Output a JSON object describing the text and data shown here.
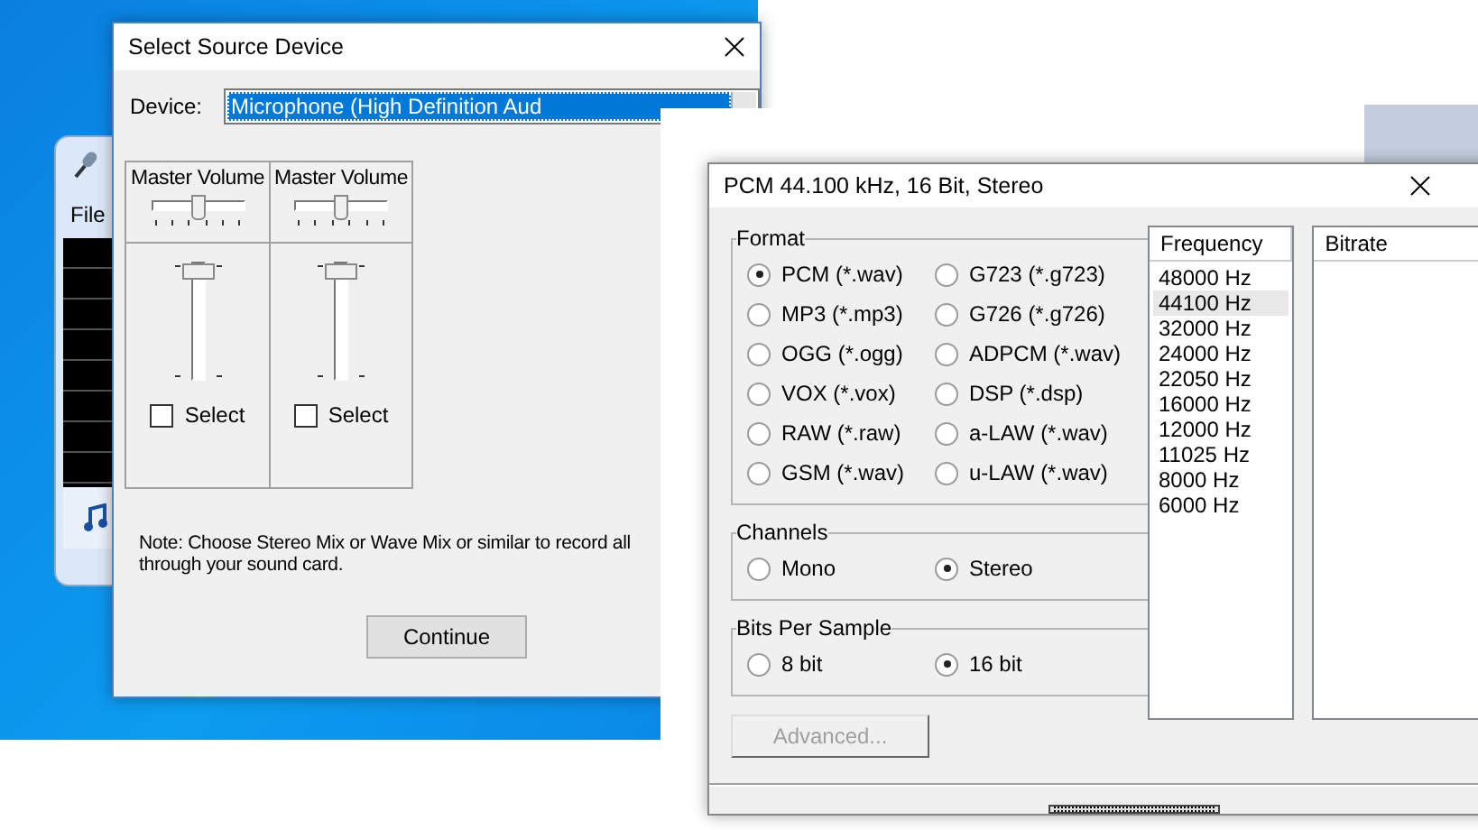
{
  "back_window": {
    "menu": "File"
  },
  "source_dialog": {
    "title": "Select Source Device",
    "device_label": "Device:",
    "device_value": "Microphone (High Definition Aud",
    "mixers": [
      {
        "label": "Master Volume",
        "balance": {
          "level": 0.5
        },
        "volume": {
          "level": 0.95
        },
        "select": {
          "label": "Select",
          "checked": false
        }
      },
      {
        "label": "Master Volume",
        "balance": {
          "level": 0.5
        },
        "volume": {
          "level": 0.95
        },
        "select": {
          "label": "Select",
          "checked": false
        }
      }
    ],
    "note_lines": [
      "Note: Choose Stereo Mix or Wave Mix or similar to record all",
      "through your sound card."
    ],
    "button": "Continue"
  },
  "format_dialog": {
    "title": "PCM 44.100 kHz, 16 Bit, Stereo",
    "format": {
      "legend": "Format",
      "options": [
        {
          "label": "PCM (*.wav)",
          "selected": true
        },
        {
          "label": "G723 (*.g723)",
          "selected": false
        },
        {
          "label": "MP3 (*.mp3)",
          "selected": false
        },
        {
          "label": "G726 (*.g726)",
          "selected": false
        },
        {
          "label": "OGG (*.ogg)",
          "selected": false
        },
        {
          "label": "ADPCM (*.wav)",
          "selected": false
        },
        {
          "label": "VOX (*.vox)",
          "selected": false
        },
        {
          "label": "DSP (*.dsp)",
          "selected": false
        },
        {
          "label": "RAW (*.raw)",
          "selected": false
        },
        {
          "label": "a-LAW (*.wav)",
          "selected": false
        },
        {
          "label": "GSM (*.wav)",
          "selected": false
        },
        {
          "label": "u-LAW (*.wav)",
          "selected": false
        }
      ]
    },
    "channels": {
      "legend": "Channels",
      "options": [
        {
          "label": "Mono",
          "selected": false
        },
        {
          "label": "Stereo",
          "selected": true
        }
      ]
    },
    "bits": {
      "legend": "Bits Per Sample",
      "options": [
        {
          "label": "8 bit",
          "selected": false
        },
        {
          "label": "16 bit",
          "selected": true
        }
      ]
    },
    "advanced_button": {
      "label": "Advanced...",
      "disabled": true
    },
    "frequency": {
      "header": "Frequency",
      "items": [
        {
          "label": "48000 Hz",
          "selected": false
        },
        {
          "label": "44100 Hz",
          "selected": true
        },
        {
          "label": "32000 Hz",
          "selected": false
        },
        {
          "label": "24000 Hz",
          "selected": false
        },
        {
          "label": "22050 Hz",
          "selected": false
        },
        {
          "label": "16000 Hz",
          "selected": false
        },
        {
          "label": "12000 Hz",
          "selected": false
        },
        {
          "label": "11025 Hz",
          "selected": false
        },
        {
          "label": "8000 Hz",
          "selected": false
        },
        {
          "label": "6000 Hz",
          "selected": false
        }
      ]
    },
    "bitrate": {
      "header": "Bitrate"
    }
  }
}
